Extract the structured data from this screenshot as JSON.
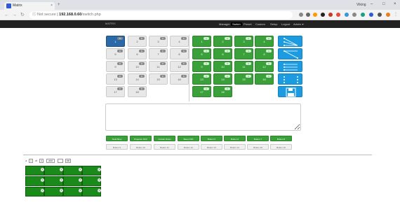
{
  "browser": {
    "tab_title": "Matrix",
    "tab_close": "×",
    "new_tab": "+",
    "user": "Viking",
    "win_min": "–",
    "win_max": "□",
    "win_close": "×",
    "secure_label": "Not secure",
    "url_host": "192.168.0.60",
    "url_path": "/switch.php"
  },
  "appnav": {
    "brand": "MATRIX",
    "items": [
      "Manager",
      "Switch",
      "Preset",
      "Custom",
      "Setup",
      "Logout",
      "Admin ▾"
    ],
    "active": "Switch"
  },
  "inputs": [
    {
      "num": "1",
      "badge": "In"
    },
    {
      "num": "2",
      "badge": "In"
    },
    {
      "num": "3",
      "badge": "In"
    },
    {
      "num": "4",
      "badge": "In"
    },
    {
      "num": "5",
      "badge": "In"
    },
    {
      "num": "6",
      "badge": "In"
    },
    {
      "num": "7",
      "badge": "In"
    },
    {
      "num": "8",
      "badge": "In"
    },
    {
      "num": "9",
      "badge": "In"
    },
    {
      "num": "10",
      "badge": "In"
    },
    {
      "num": "11",
      "badge": "In"
    },
    {
      "num": "12",
      "badge": "In"
    },
    {
      "num": "13",
      "badge": "In"
    },
    {
      "num": "14",
      "badge": "In"
    },
    {
      "num": "15",
      "badge": "In"
    },
    {
      "num": "16",
      "badge": "In"
    },
    {
      "num": "17",
      "badge": "In"
    },
    {
      "num": "18",
      "badge": "In"
    }
  ],
  "outputs": [
    {
      "num": "1",
      "badge": "1"
    },
    {
      "num": "2",
      "badge": "1"
    },
    {
      "num": "3",
      "badge": "1"
    },
    {
      "num": "4",
      "badge": "1"
    },
    {
      "num": "5",
      "badge": "1"
    },
    {
      "num": "6",
      "badge": "1"
    },
    {
      "num": "7",
      "badge": "1"
    },
    {
      "num": "8",
      "badge": "1"
    },
    {
      "num": "9",
      "badge": "1"
    },
    {
      "num": "10",
      "badge": "1"
    },
    {
      "num": "11",
      "badge": "1"
    },
    {
      "num": "12",
      "badge": "1"
    },
    {
      "num": "13",
      "badge": "1"
    },
    {
      "num": "14",
      "badge": "1"
    },
    {
      "num": "15",
      "badge": "1"
    },
    {
      "num": "16",
      "badge": "1"
    },
    {
      "num": "17",
      "badge": "1"
    },
    {
      "num": "18",
      "badge": "1"
    }
  ],
  "macros_row1": [
    "Switchboy",
    "Projector OFF",
    "Curtain Down",
    "Beep OFF",
    "Button 5",
    "Button 6",
    "Button 7",
    "Button 8"
  ],
  "macros_row2": [
    "Button 9",
    "Button 10",
    "Button 11",
    "Button 12",
    "Button 13",
    "Button 14",
    "Button 15",
    "Button 16"
  ],
  "controls": {
    "arrow_left": "◂",
    "page_value": "1",
    "of_label": "of",
    "total": "4",
    "add_label": "add",
    "go_label": "del"
  },
  "grid": {
    "rows": 3,
    "cols": 4,
    "dot_label": "×"
  },
  "colors": {
    "selected_input": "#2a6aa8",
    "output_green": "#3aa03a",
    "tool_blue": "#1c9be0",
    "grid_green": "#1a8a1a"
  }
}
